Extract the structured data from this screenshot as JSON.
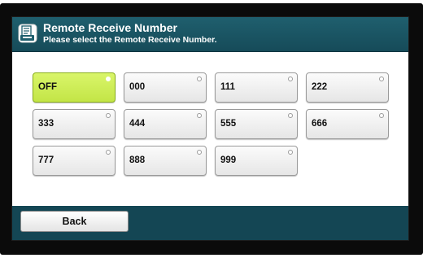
{
  "header": {
    "title": "Remote Receive Number",
    "subtitle": "Please select the Remote Receive Number.",
    "icon": "fax-document-icon",
    "background_color": "#1a5665"
  },
  "options": [
    {
      "label": "OFF",
      "selected": true
    },
    {
      "label": "000",
      "selected": false
    },
    {
      "label": "111",
      "selected": false
    },
    {
      "label": "222",
      "selected": false
    },
    {
      "label": "333",
      "selected": false
    },
    {
      "label": "444",
      "selected": false
    },
    {
      "label": "555",
      "selected": false
    },
    {
      "label": "666",
      "selected": false
    },
    {
      "label": "777",
      "selected": false
    },
    {
      "label": "888",
      "selected": false
    },
    {
      "label": "999",
      "selected": false
    }
  ],
  "selected_color": "#c8ea4f",
  "footer": {
    "back_label": "Back"
  }
}
